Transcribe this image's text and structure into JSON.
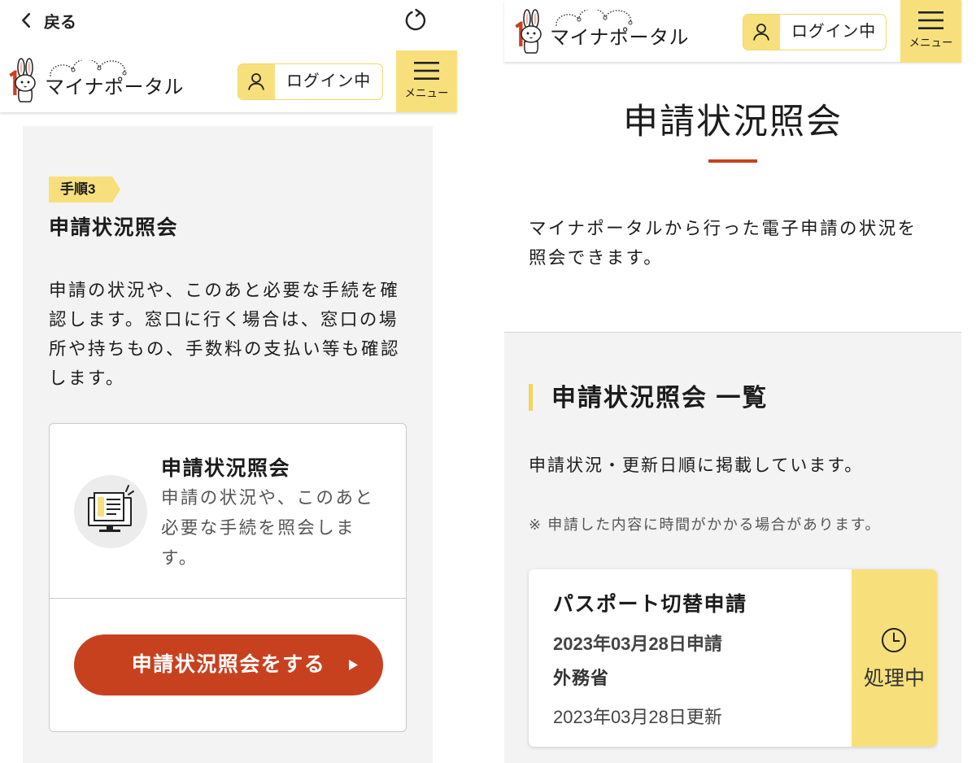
{
  "left": {
    "topbar": {
      "back_label": "戻る",
      "back_icon": "chevron-left-icon",
      "refresh_icon": "refresh-icon"
    },
    "header": {
      "logo_text": "マイナポータル",
      "login_label": "ログイン中",
      "menu_label": "メニュー"
    },
    "step": {
      "badge": "手順3",
      "title": "申請状況照会",
      "description_lines": [
        "申請の状況や、このあと必要な手続を確",
        "認します。窓口に行く場合は、窓口の場",
        "所や持ちもの、手数料の支払い等も確認",
        "します。"
      ]
    },
    "card": {
      "icon": "computer-document-icon",
      "title": "申請状況照会",
      "description_lines": [
        "申請の状況や、このあと",
        "必要な手続を照会しま",
        "す。"
      ],
      "button_label": "申請状況照会をする"
    }
  },
  "right": {
    "header": {
      "logo_text": "マイナポータル",
      "login_label": "ログイン中",
      "menu_label": "メニュー"
    },
    "page_title": "申請状況照会",
    "intro_lines": [
      "マイナポータルから行った電子申請の状況を",
      "照会できます。"
    ],
    "list": {
      "heading": "申請状況照会 一覧",
      "sort_note": "申請状況・更新日順に掲載しています。",
      "caution": "※ 申請した内容に時間がかかる場合があります。",
      "items": [
        {
          "title": "パスポート切替申請",
          "applied": "2023年03月28日申請",
          "agency": "外務省",
          "updated": "2023年03月28日更新",
          "status": "処理中",
          "status_icon": "clock-icon"
        }
      ]
    }
  },
  "colors": {
    "accent_yellow": "#f7e07c",
    "primary_red": "#c8411f",
    "section_gray": "#f3f3f3",
    "text": "#1c1c1c"
  }
}
